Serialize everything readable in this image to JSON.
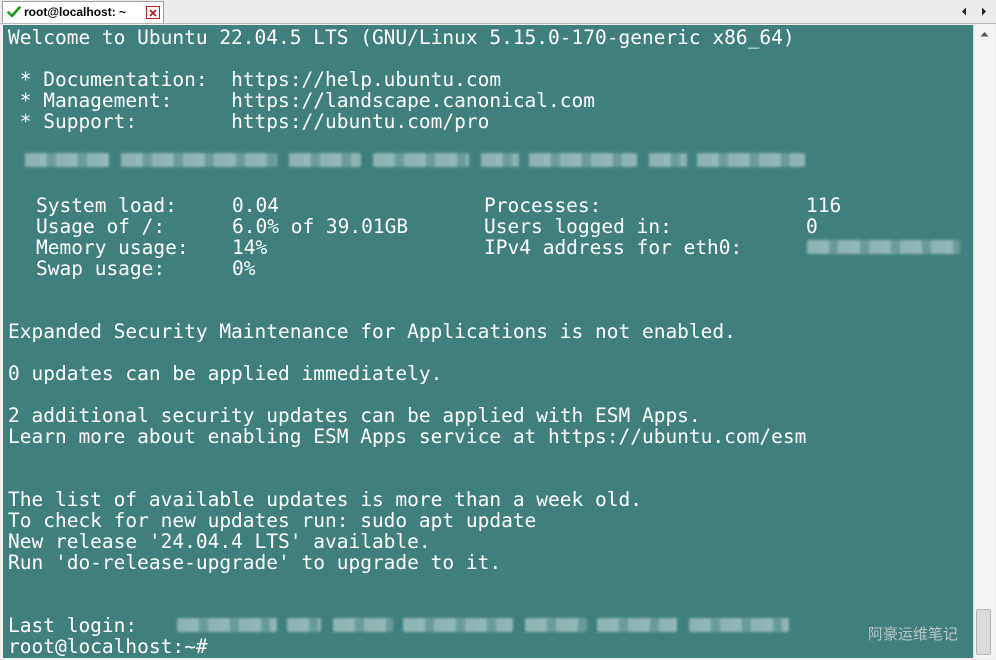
{
  "tab": {
    "title": "root@localhost: ~",
    "status_icon": "check-icon",
    "close_icon": "close-icon"
  },
  "nav": {
    "left_icon": "chevron-left-icon",
    "right_icon": "chevron-right-icon"
  },
  "terminal": {
    "colors": {
      "background": "#3f807c",
      "foreground": "#ffffff"
    },
    "welcome": "Welcome to Ubuntu 22.04.5 LTS (GNU/Linux 5.15.0-170-generic x86_64)",
    "links": [
      {
        "label": " * Documentation:  ",
        "url": "https://help.ubuntu.com"
      },
      {
        "label": " * Management:     ",
        "url": "https://landscape.canonical.com"
      },
      {
        "label": " * Support:        ",
        "url": "https://ubuntu.com/pro"
      }
    ],
    "sysinfo": {
      "system_load_label": "System load:",
      "system_load": "0.04",
      "usage_label": "Usage of /:",
      "usage": "6.0% of 39.01GB",
      "memory_label": "Memory usage:",
      "memory": "14%",
      "swap_label": "Swap usage:",
      "swap": "0%",
      "processes_label": "Processes:",
      "processes": "116",
      "users_label": "Users logged in:",
      "users": "0",
      "ipv4_label": "IPv4 address for eth0:"
    },
    "esm": "Expanded Security Maintenance for Applications is not enabled.",
    "updates": "0 updates can be applied immediately.",
    "security_updates": "2 additional security updates can be applied with ESM Apps.",
    "learn_more": "Learn more about enabling ESM Apps service at https://ubuntu.com/esm",
    "list_old": "The list of available updates is more than a week old.",
    "check_updates": "To check for new updates run: sudo apt update",
    "new_release": "New release '24.04.4 LTS' available.",
    "run_upgrade": "Run 'do-release-upgrade' to upgrade to it.",
    "last_login_label": "Last login: ",
    "prompt": "root@localhost:~#"
  },
  "watermark": "阿豪运维笔记"
}
